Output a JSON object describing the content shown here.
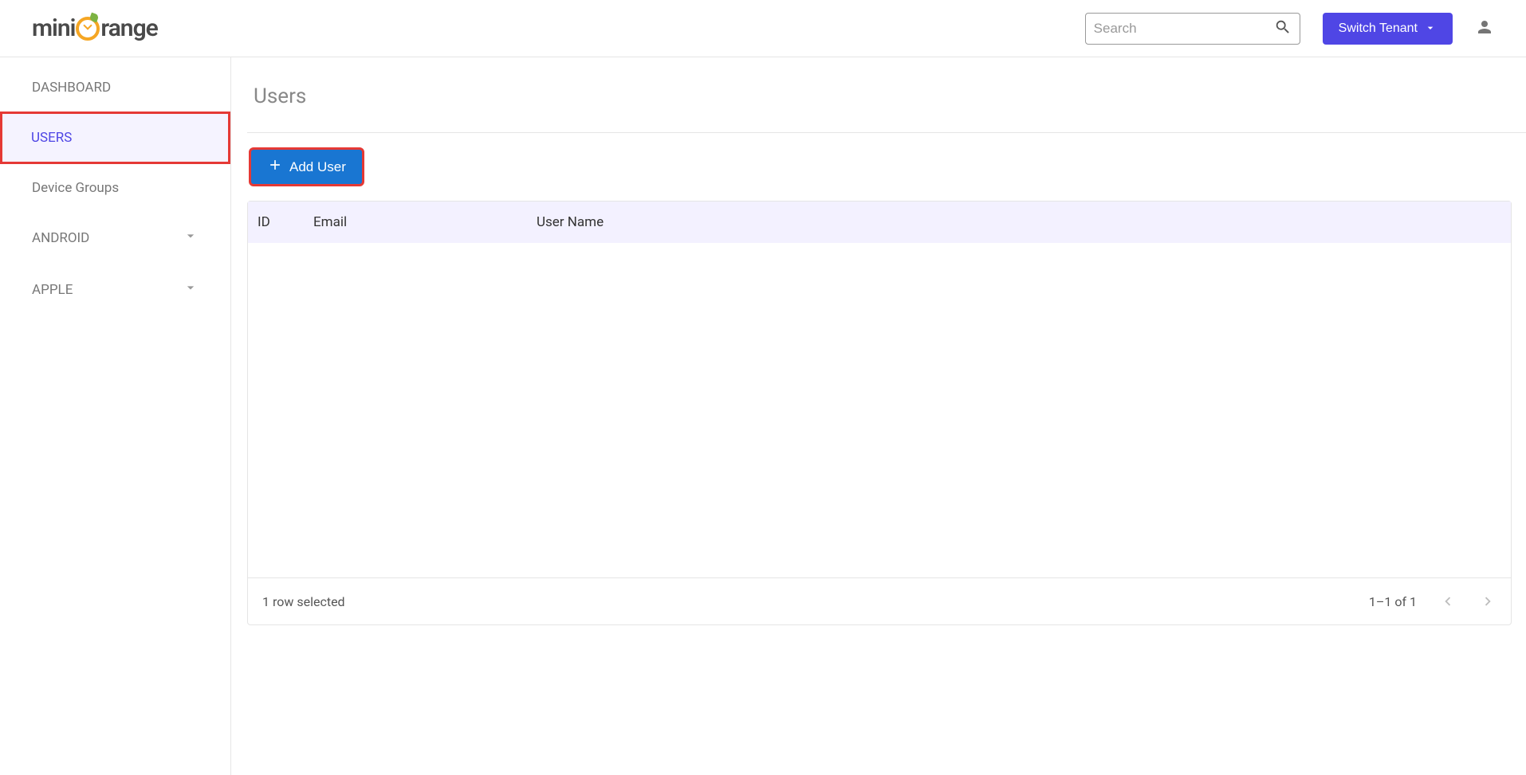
{
  "header": {
    "logo_prefix": "mini",
    "logo_suffix": "range",
    "search_placeholder": "Search",
    "switch_tenant_label": "Switch Tenant"
  },
  "sidebar": {
    "items": [
      {
        "label": "DASHBOARD",
        "upper": true
      },
      {
        "label": "USERS",
        "upper": true,
        "active": true,
        "highlighted": true
      },
      {
        "label": "Device Groups"
      },
      {
        "label": "ANDROID",
        "upper": true,
        "expandable": true
      },
      {
        "label": "APPLE",
        "upper": true,
        "expandable": true
      }
    ]
  },
  "main": {
    "title": "Users",
    "add_user_label": "Add User",
    "columns": {
      "id": "ID",
      "email": "Email",
      "username": "User Name"
    },
    "footer": {
      "selection_text": "1 row selected",
      "range_text": "1–1 of 1"
    }
  }
}
